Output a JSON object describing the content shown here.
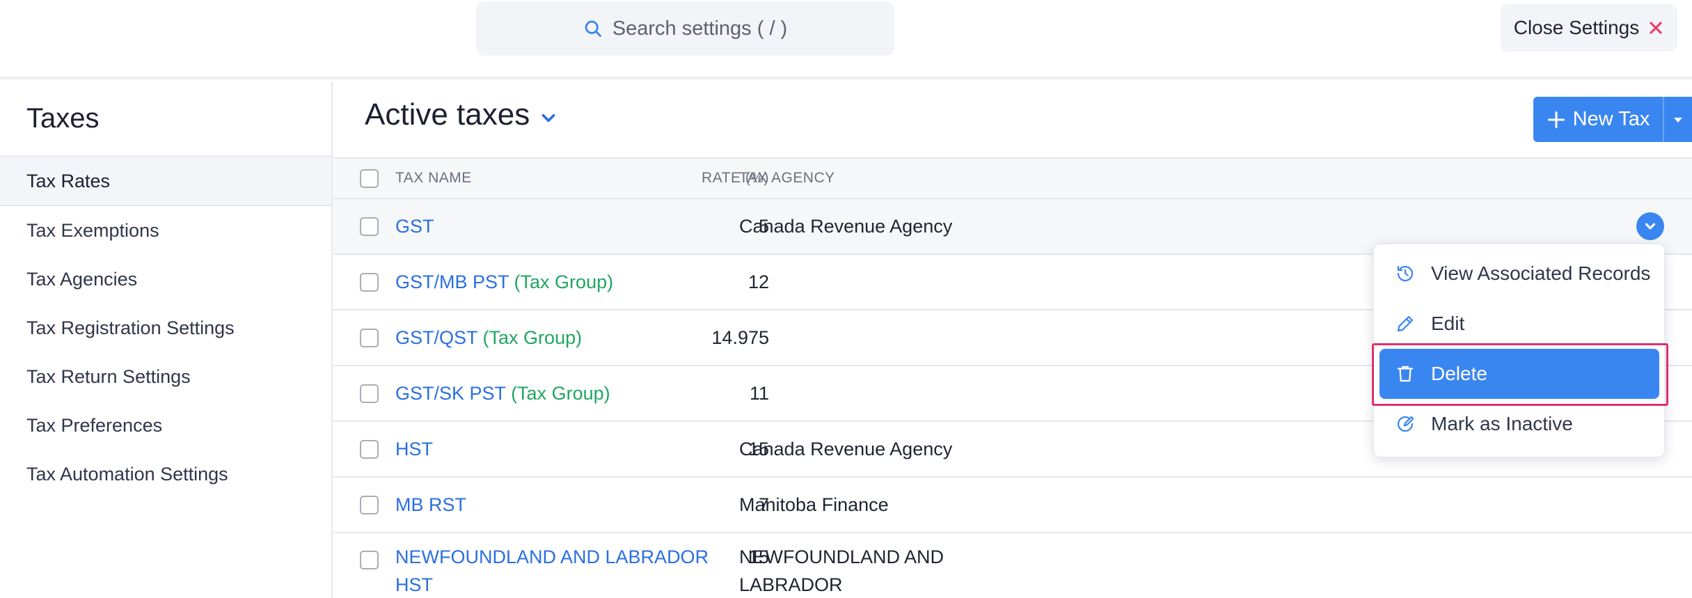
{
  "topbar": {
    "search_placeholder": "Search settings ( / )",
    "close_label": "Close Settings"
  },
  "sidebar": {
    "title": "Taxes",
    "items": [
      {
        "label": "Tax Rates",
        "active": true
      },
      {
        "label": "Tax Exemptions"
      },
      {
        "label": "Tax Agencies"
      },
      {
        "label": "Tax Registration Settings"
      },
      {
        "label": "Tax Return Settings"
      },
      {
        "label": "Tax Preferences"
      },
      {
        "label": "Tax Automation Settings"
      }
    ]
  },
  "main": {
    "view_title": "Active taxes",
    "new_button_label": "New Tax",
    "columns": {
      "name": "TAX NAME",
      "agency": "TAX AGENCY",
      "rate": "RATE (%)"
    },
    "rows": [
      {
        "name": "GST",
        "group_label": "",
        "agency": "Canada Revenue Agency",
        "rate": "5"
      },
      {
        "name": "GST/MB PST",
        "group_label": "(Tax Group)",
        "agency": "",
        "rate": "12"
      },
      {
        "name": "GST/QST",
        "group_label": "(Tax Group)",
        "agency": "",
        "rate": "14.975"
      },
      {
        "name": "GST/SK PST",
        "group_label": "(Tax Group)",
        "agency": "",
        "rate": "11"
      },
      {
        "name": "HST",
        "group_label": "",
        "agency": "Canada Revenue Agency",
        "rate": "15"
      },
      {
        "name": "MB RST",
        "group_label": "",
        "agency": "Manitoba Finance",
        "rate": "7"
      },
      {
        "name": "NEWFOUNDLAND AND LABRADOR HST",
        "group_label": "",
        "agency": "NEWFOUNDLAND AND LABRADOR",
        "rate": "15"
      }
    ]
  },
  "row_menu": {
    "items": [
      {
        "label": "View Associated Records",
        "icon": "history-icon"
      },
      {
        "label": "Edit",
        "icon": "pencil-icon"
      },
      {
        "label": "Delete",
        "icon": "trash-icon",
        "selected": true
      },
      {
        "label": "Mark as Inactive",
        "icon": "inactive-icon"
      }
    ]
  },
  "colors": {
    "accent": "#3a86f0",
    "link": "#2a6fe0",
    "tax_group": "#21a562",
    "highlight": "#e0306b",
    "close_icon": "#e8426d"
  }
}
